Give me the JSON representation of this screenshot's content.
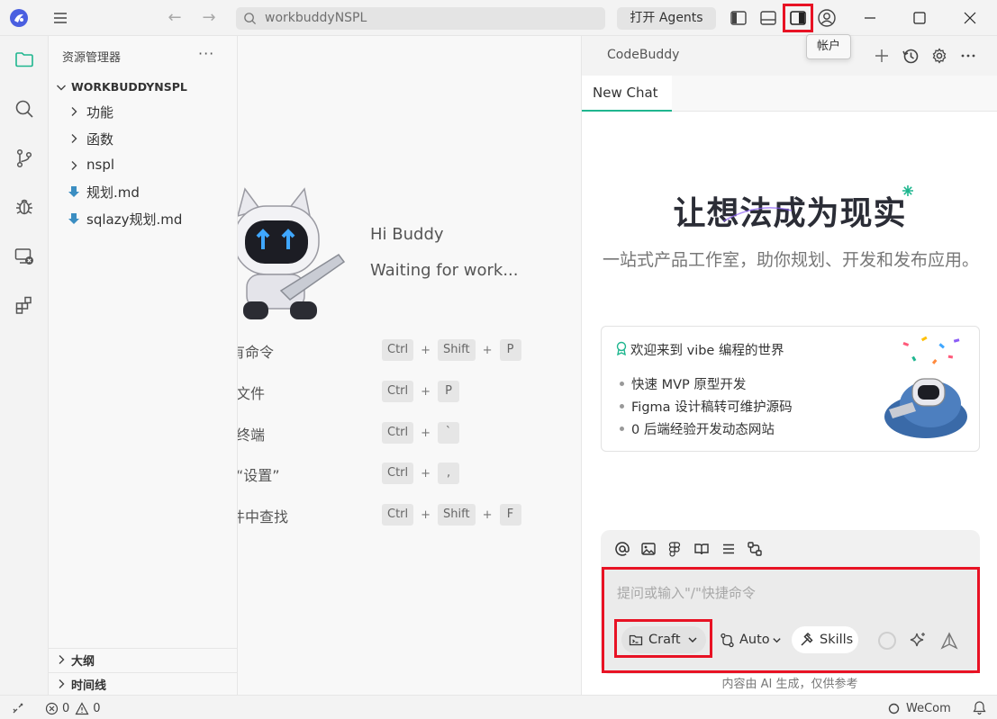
{
  "titlebar": {
    "search_text": "workbuddyNSPL",
    "agents_label": "打开 Agents",
    "tooltip": "帐户"
  },
  "sidebar": {
    "title": "资源管理器",
    "more": "···",
    "root": "WORKBUDDYNSPL",
    "items": [
      {
        "label": "功能",
        "kind": "folder"
      },
      {
        "label": "函数",
        "kind": "folder"
      },
      {
        "label": "nspl",
        "kind": "folder"
      },
      {
        "label": "规划.md",
        "kind": "md"
      },
      {
        "label": "sqlazy规划.md",
        "kind": "md"
      }
    ],
    "outline": "大纲",
    "timeline": "时间线"
  },
  "editor": {
    "greeting": "Hi Buddy",
    "status": "Waiting for work...",
    "commands": [
      {
        "label": "所有命令",
        "keys": [
          "Ctrl",
          "Shift",
          "P"
        ]
      },
      {
        "label": "打开文件",
        "keys": [
          "Ctrl",
          "P"
        ]
      },
      {
        "label": "切换终端",
        "keys": [
          "Ctrl",
          "`"
        ]
      },
      {
        "label": "打开“设置”",
        "keys": [
          "Ctrl",
          ","
        ]
      },
      {
        "label": "在文件中查找",
        "keys": [
          "Ctrl",
          "Shift",
          "F"
        ]
      }
    ]
  },
  "chat": {
    "title": "CodeBuddy",
    "tab": "New Chat",
    "hero": "让想法成为现实",
    "subtitle": "一站式产品工作室，助你规划、开发和发布应用。",
    "card": {
      "title": "欢迎来到 vibe 编程的世界",
      "bullets": [
        "快速 MVP 原型开发",
        "Figma 设计稿转可维护源码",
        "0 后端经验开发动态网站"
      ]
    },
    "placeholder": "提问或输入\"/\"快捷命令",
    "mode_label": "Craft",
    "model_label": "Auto",
    "skills_label": "Skills",
    "disclaimer": "内容由 AI 生成，仅供参考"
  },
  "statusbar": {
    "errors": "0",
    "warnings": "0",
    "wecom": "WeCom"
  },
  "colors": {
    "accent": "#1fb68f",
    "highlight": "#e81224",
    "logo": "#4a5fe0"
  }
}
